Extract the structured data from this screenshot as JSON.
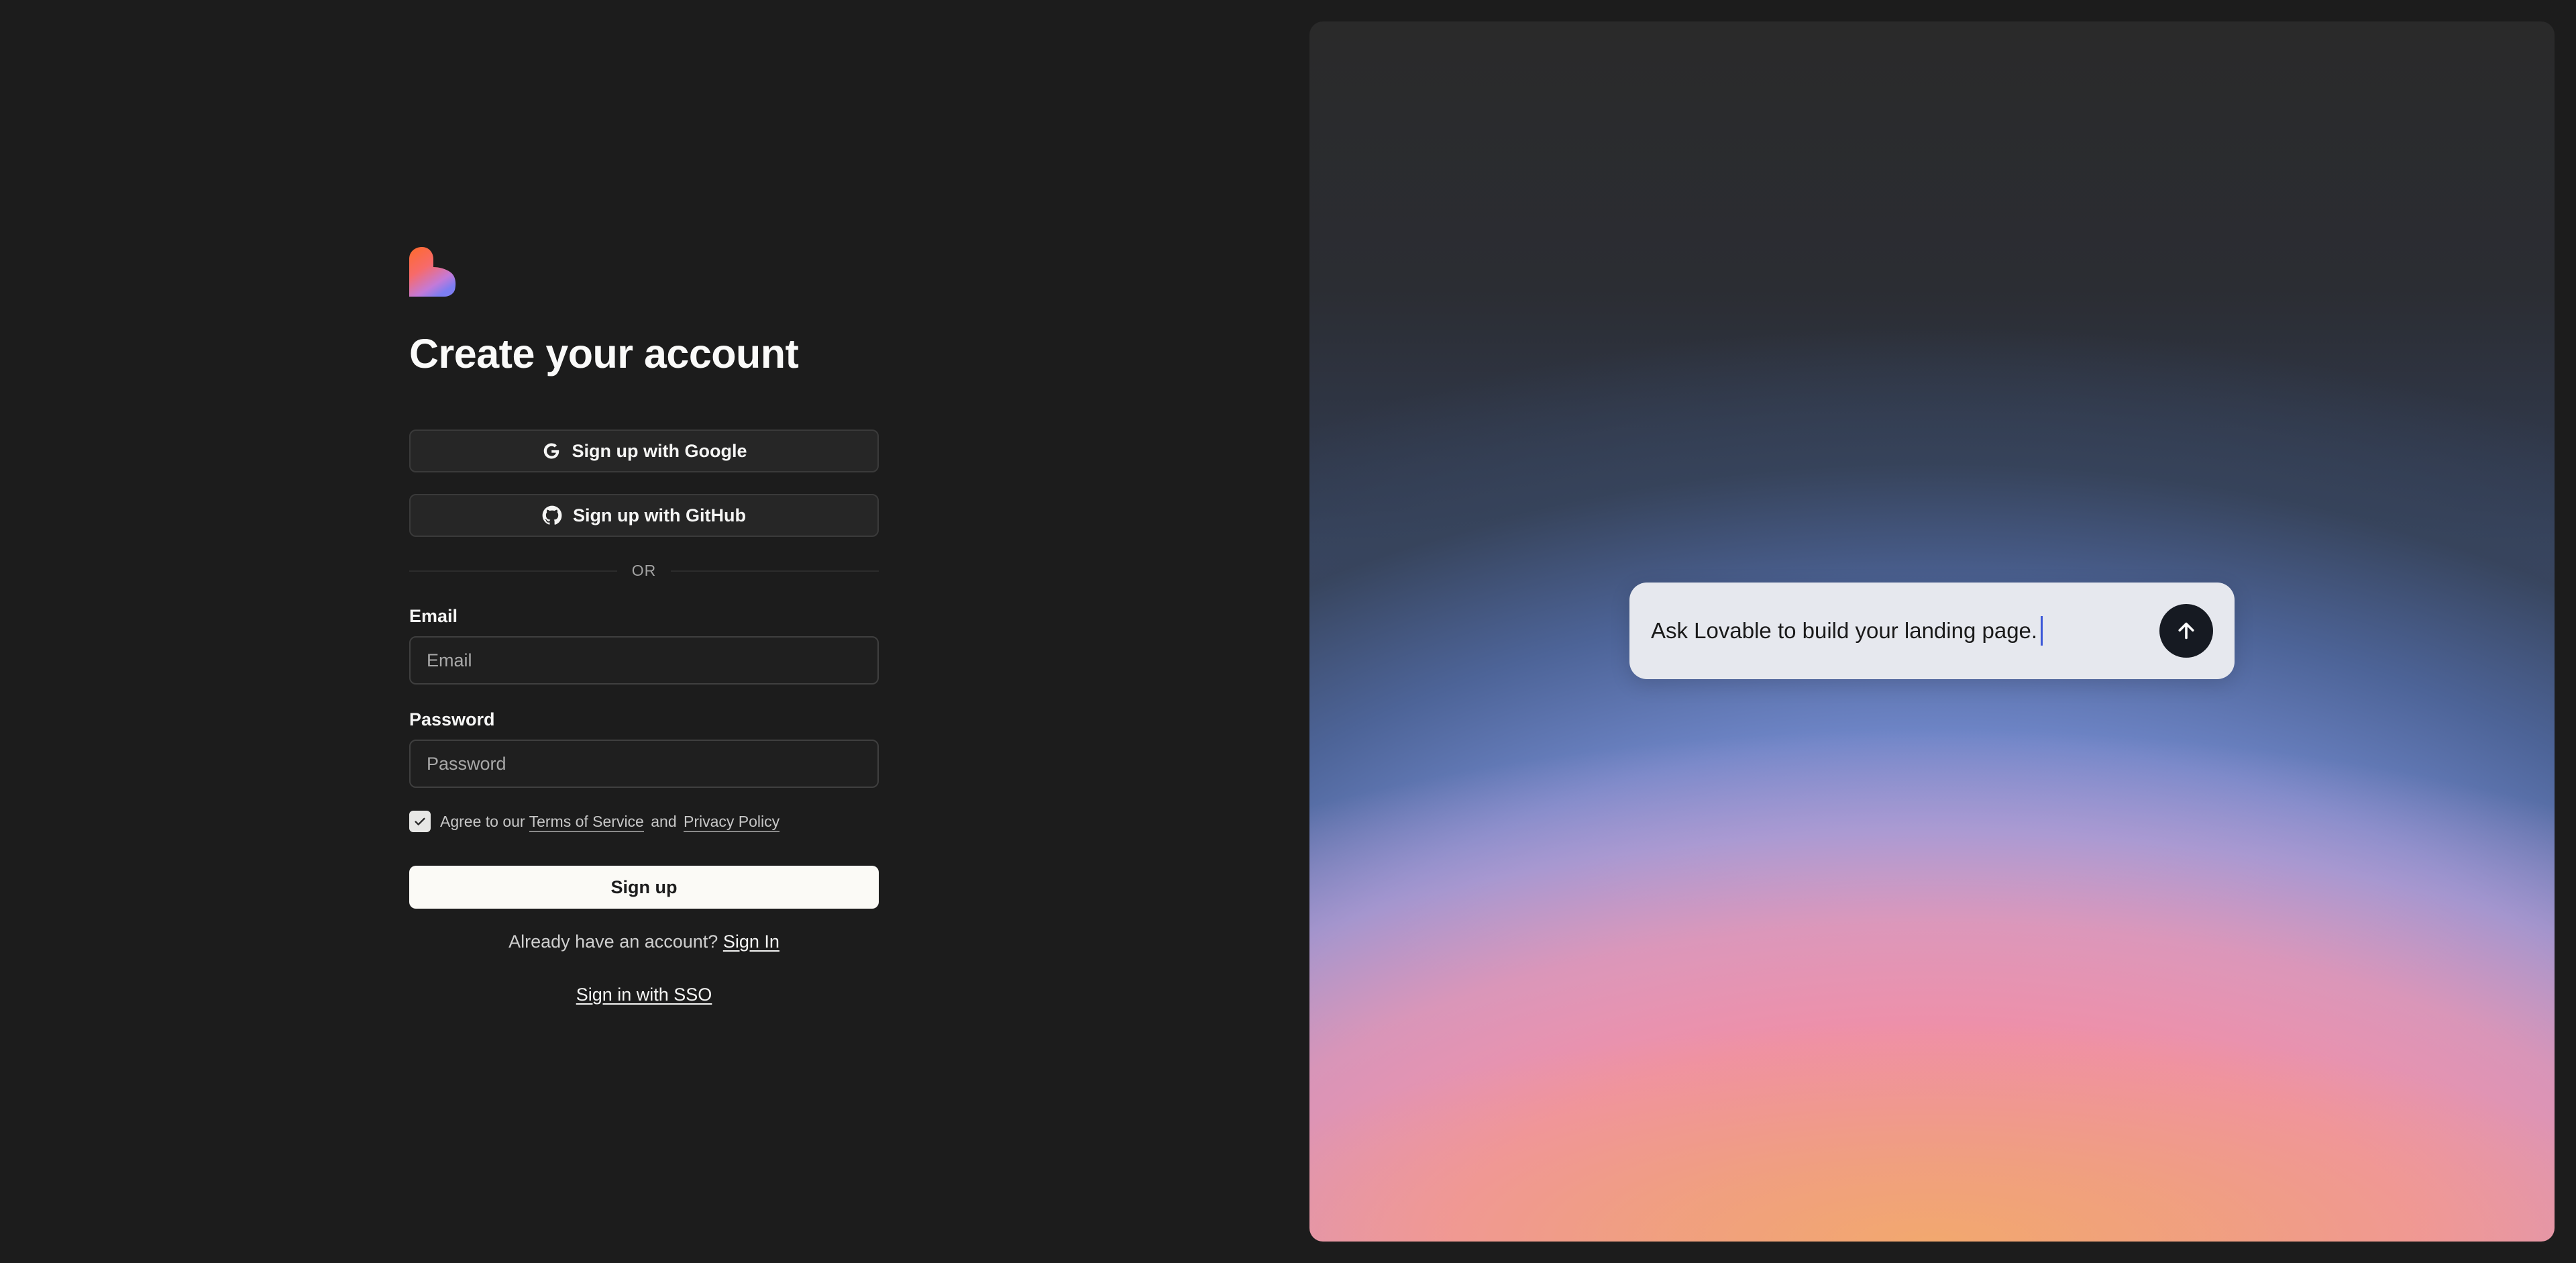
{
  "signup": {
    "title": "Create your account",
    "google_label": "Sign up with Google",
    "github_label": "Sign up with GitHub",
    "divider": "OR",
    "email_label": "Email",
    "email_placeholder": "Email",
    "email_value": "",
    "password_label": "Password",
    "password_placeholder": "Password",
    "password_value": "",
    "agree_prefix": "Agree to our",
    "terms_link": "Terms of Service",
    "agree_and": "and",
    "privacy_link": "Privacy Policy",
    "agree_checked": true,
    "submit_label": "Sign up",
    "have_account_text": "Already have an account?",
    "sign_in_link": "Sign In",
    "sso_link": "Sign in with SSO"
  },
  "hero": {
    "prompt_text": "Ask Lovable to build your landing page.",
    "send_icon": "arrow-up-icon"
  },
  "icons": {
    "logo": "lovable-heart-logo",
    "google": "google-icon",
    "github": "github-icon",
    "check": "check-icon"
  },
  "colors": {
    "background": "#1c1c1c",
    "primary_button": "#fbfaf6",
    "send_button": "#161a22",
    "caret": "#3b57d8"
  }
}
